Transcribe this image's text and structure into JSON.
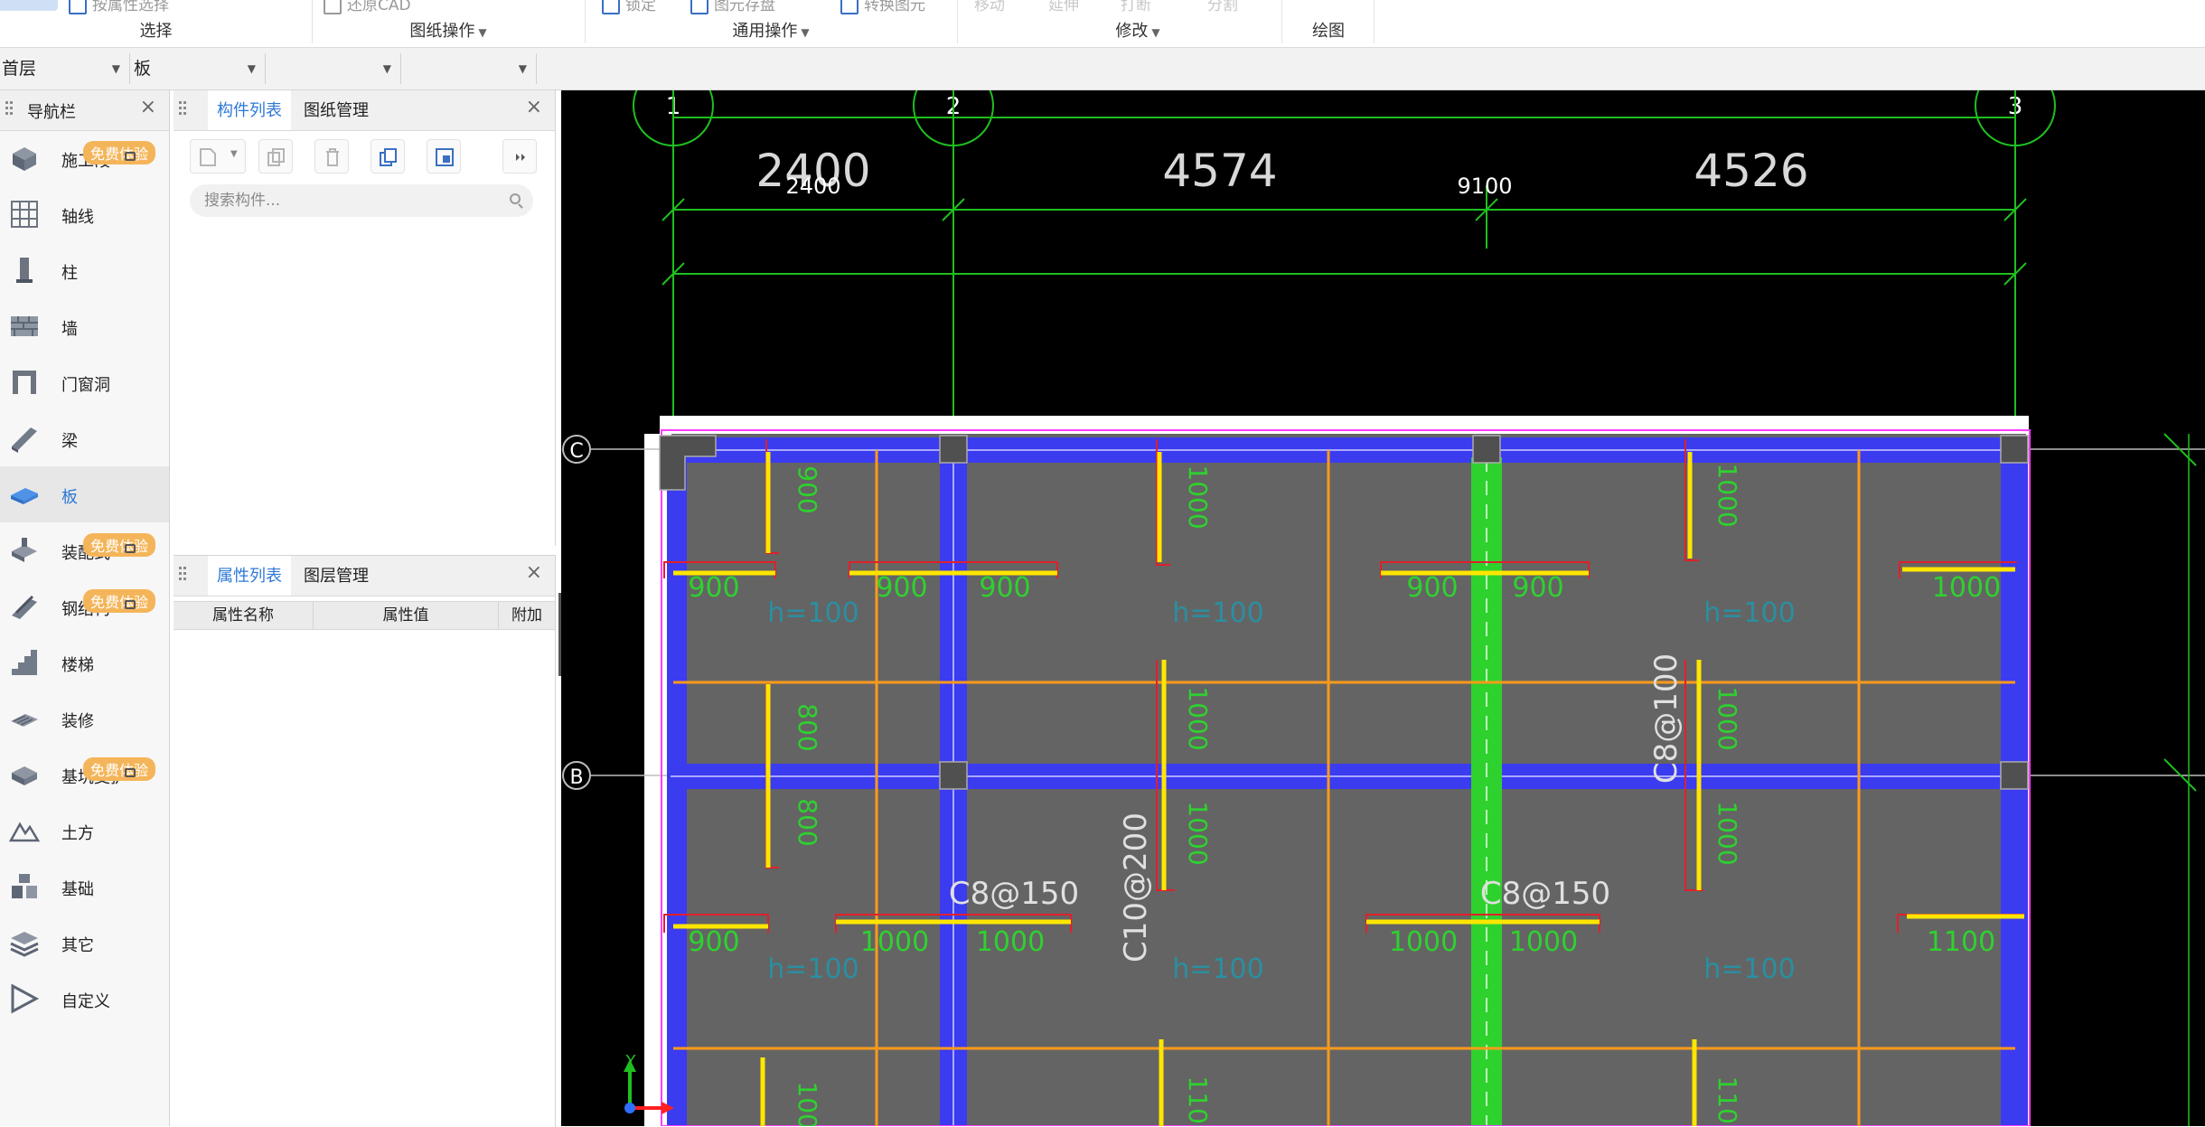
{
  "ribbon": {
    "groups": [
      {
        "title": "选择"
      },
      {
        "title": "图纸操作"
      },
      {
        "title": "通用操作"
      },
      {
        "title": "修改"
      },
      {
        "title": "绘图"
      }
    ],
    "top_items": [
      "按属性选择",
      "还原CAD",
      "锁定",
      "图元存盘",
      "转换图元",
      "移动",
      "延伸",
      "打断",
      "分割"
    ]
  },
  "floorbar": {
    "floor": "首层",
    "type": "板",
    "sel3": "",
    "sel4": ""
  },
  "nav": {
    "title": "导航栏",
    "badge_text": "免费体验",
    "items": [
      {
        "label": "施工段",
        "icon": "construction-segment-icon"
      },
      {
        "label": "轴线",
        "icon": "grid-axis-icon"
      },
      {
        "label": "柱",
        "icon": "column-icon"
      },
      {
        "label": "墙",
        "icon": "wall-icon"
      },
      {
        "label": "门窗洞",
        "icon": "door-window-icon"
      },
      {
        "label": "梁",
        "icon": "beam-icon"
      },
      {
        "label": "板",
        "icon": "slab-icon"
      },
      {
        "label": "装配式",
        "icon": "prefab-icon"
      },
      {
        "label": "钢结构",
        "icon": "steel-icon"
      },
      {
        "label": "楼梯",
        "icon": "stair-icon"
      },
      {
        "label": "装修",
        "icon": "decoration-icon"
      },
      {
        "label": "基坑支护",
        "icon": "foundation-pit-icon"
      },
      {
        "label": "土方",
        "icon": "earthwork-icon"
      },
      {
        "label": "基础",
        "icon": "foundation-icon"
      },
      {
        "label": "其它",
        "icon": "other-icon"
      },
      {
        "label": "自定义",
        "icon": "custom-icon"
      }
    ]
  },
  "component_panel": {
    "tabs": [
      "构件列表",
      "图纸管理"
    ],
    "search_placeholder": "搜索构件..."
  },
  "property_panel": {
    "tabs": [
      "属性列表",
      "图层管理"
    ],
    "columns": [
      "属性名称",
      "属性值",
      "附加"
    ]
  },
  "drawing": {
    "axes_x": [
      "1",
      "2",
      "3"
    ],
    "axes_y": [
      "C",
      "B"
    ],
    "dims": [
      "2400",
      "4574",
      "4526"
    ],
    "small_dims": [
      "2400",
      "9100"
    ],
    "slab_thickness": "h=100",
    "rebar_labels": [
      "C8@150",
      "C10@200",
      "C8@100"
    ],
    "rebar_lengths": [
      "900",
      "1000",
      "800",
      "1100"
    ],
    "axis_y_label": "Y"
  },
  "colors": {
    "accent": "#2f78d6",
    "badge": "#f4b55a",
    "canvas_bg": "#000000",
    "slab": "#646464",
    "beam": "#3b3bf0",
    "highlight_beam": "#2fd12f",
    "rebar": "#ffe600",
    "dim_line": "#1fbf1f"
  }
}
